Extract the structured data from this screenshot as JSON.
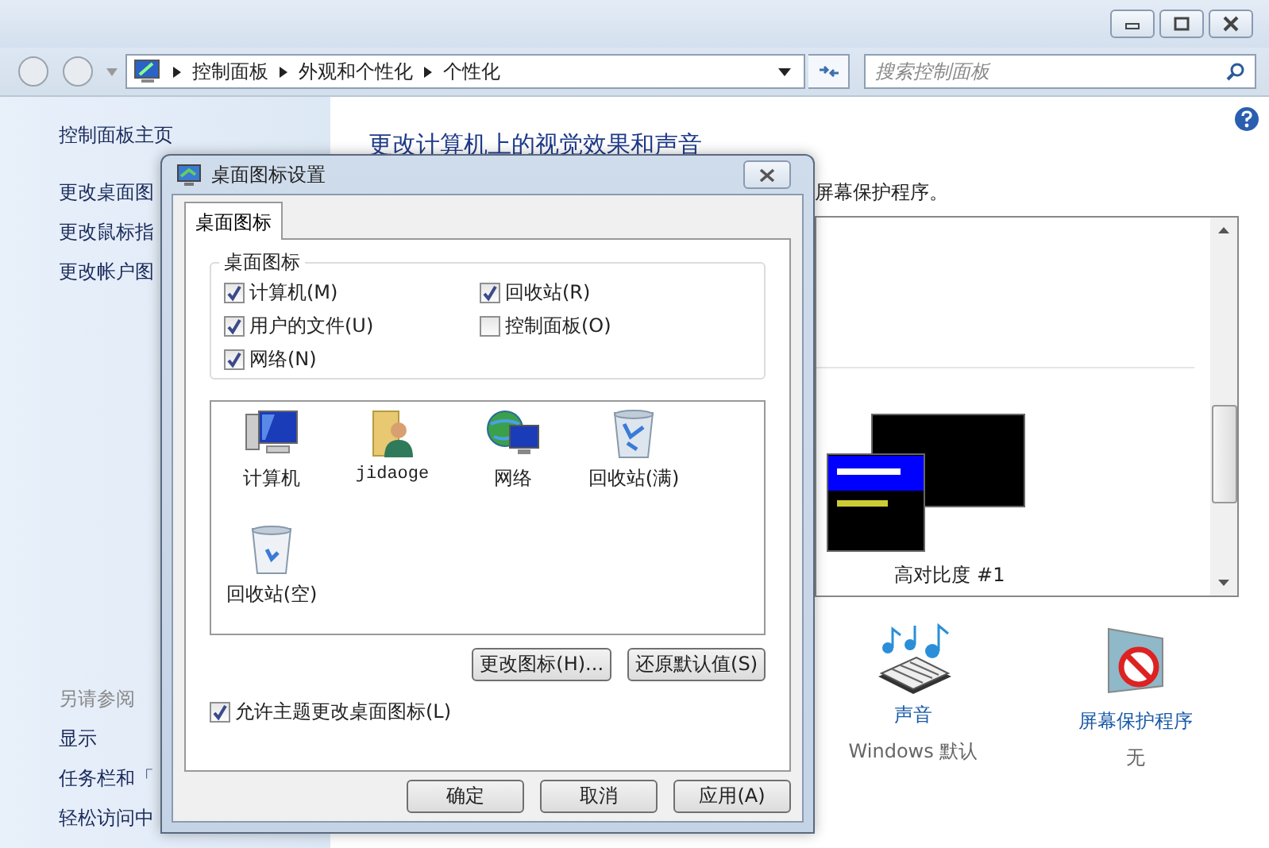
{
  "address_bar": {
    "breadcrumbs": [
      "控制面板",
      "外观和个性化",
      "个性化"
    ]
  },
  "search": {
    "placeholder": "搜索控制面板"
  },
  "sidebar": {
    "home": "控制面板主页",
    "links": [
      "更改桌面图",
      "更改鼠标指",
      "更改帐户图"
    ],
    "see_also_title": "另请参阅",
    "see_also": [
      "显示",
      "任务栏和「",
      "轻松访问中"
    ]
  },
  "main": {
    "heading": "更改计算机上的视觉效果和声音",
    "subtitle": "屏幕保护程序。",
    "theme_label": "高对比度 #1",
    "settings": [
      {
        "kind": "sound",
        "title": "声音",
        "value": "Windows 默认"
      },
      {
        "kind": "screensaver",
        "title": "屏幕保护程序",
        "value": "无"
      }
    ]
  },
  "dialog": {
    "title": "桌面图标设置",
    "tabs": [
      {
        "label": "桌面图标",
        "selected": true
      }
    ],
    "group_title": "桌面图标",
    "checkboxes": [
      {
        "label": "计算机(M)",
        "checked": true
      },
      {
        "label": "回收站(R)",
        "checked": true
      },
      {
        "label": "用户的文件(U)",
        "checked": true
      },
      {
        "label": "控制面板(O)",
        "checked": false
      },
      {
        "label": "网络(N)",
        "checked": true
      }
    ],
    "icons": [
      {
        "kind": "computer",
        "label": "计算机"
      },
      {
        "kind": "user",
        "label": "jidaoge"
      },
      {
        "kind": "network",
        "label": "网络"
      },
      {
        "kind": "bin_full",
        "label": "回收站(满)"
      },
      {
        "kind": "bin_empty",
        "label": "回收站(空)"
      }
    ],
    "icon_buttons": [
      "更改图标(H)...",
      "还原默认值(S)"
    ],
    "allow_theme": {
      "label": "允许主题更改桌面图标(L)",
      "checked": true
    },
    "buttons": [
      "确定",
      "取消",
      "应用(A)"
    ]
  }
}
